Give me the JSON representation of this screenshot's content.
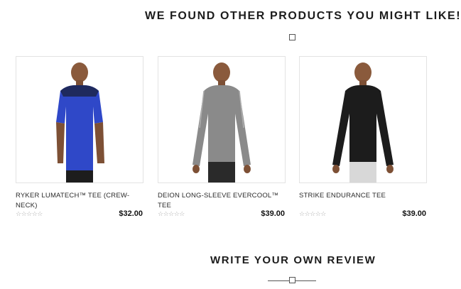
{
  "related": {
    "title": "WE FOUND OTHER PRODUCTS YOU MIGHT LIKE!",
    "products": [
      {
        "name": "RYKER LUMATECH™ TEE (CREW-NECK)",
        "price": "$32.00",
        "rating_stars": "☆☆☆☆☆",
        "shirt_color": "#2f48c8",
        "shoulder_color": "#1f2a5e",
        "pants_color": "#1d1d1d",
        "image": "man-blue-short-sleeve-tee"
      },
      {
        "name": "DEION LONG-SLEEVE EVERCOOL™ TEE",
        "price": "$39.00",
        "rating_stars": "☆☆☆☆☆",
        "shirt_color": "#8a8a8a",
        "shoulder_color": "#9a9a9a",
        "pants_color": "#2a2a2a",
        "image": "man-gray-long-sleeve-tee"
      },
      {
        "name": "STRIKE ENDURANCE TEE",
        "price": "$39.00",
        "rating_stars": "☆☆☆☆☆",
        "shirt_color": "#1c1c1c",
        "shoulder_color": "#2a2a2a",
        "pants_color": "#d8d8d8",
        "image": "man-black-long-sleeve-tee"
      }
    ]
  },
  "review": {
    "title": "WRITE YOUR OWN REVIEW"
  }
}
